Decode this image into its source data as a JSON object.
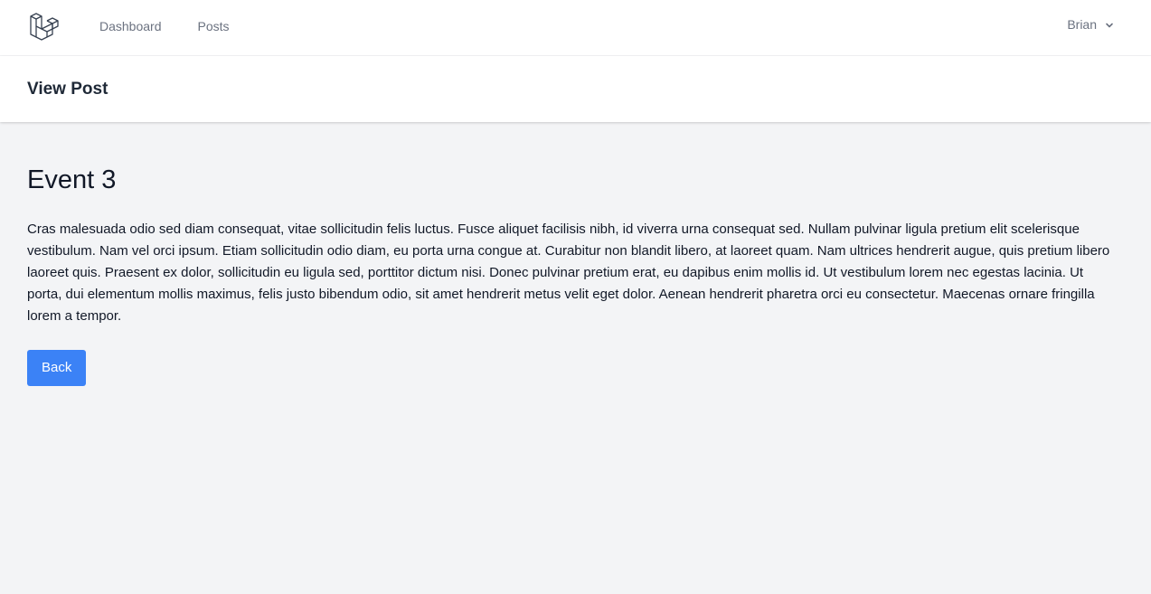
{
  "nav": {
    "logo_icon": "laravel-logo-icon",
    "links": [
      {
        "label": "Dashboard"
      },
      {
        "label": "Posts"
      }
    ],
    "user": {
      "name": "Brian",
      "icon": "chevron-down-icon"
    }
  },
  "header": {
    "title": "View Post"
  },
  "post": {
    "title": "Event 3",
    "body": "Cras malesuada odio sed diam consequat, vitae sollicitudin felis luctus. Fusce aliquet facilisis nibh, id viverra urna consequat sed. Nullam pulvinar ligula pretium elit scelerisque vestibulum. Nam vel orci ipsum. Etiam sollicitudin odio diam, eu porta urna congue at. Curabitur non blandit libero, at laoreet quam. Nam ultrices hendrerit augue, quis pretium libero laoreet quis. Praesent ex dolor, sollicitudin eu ligula sed, porttitor dictum nisi. Donec pulvinar pretium erat, eu dapibus enim mollis id. Ut vestibulum lorem nec egestas lacinia. Ut porta, dui elementum mollis maximus, felis justo bibendum odio, sit amet hendrerit metus velit eget dolor. Aenean hendrerit pharetra orci eu consectetur. Maecenas ornare fringilla lorem a tempor."
  },
  "actions": {
    "back_label": "Back"
  },
  "colors": {
    "accent": "#3b82f6",
    "background": "#f3f4f6",
    "surface": "#ffffff"
  }
}
